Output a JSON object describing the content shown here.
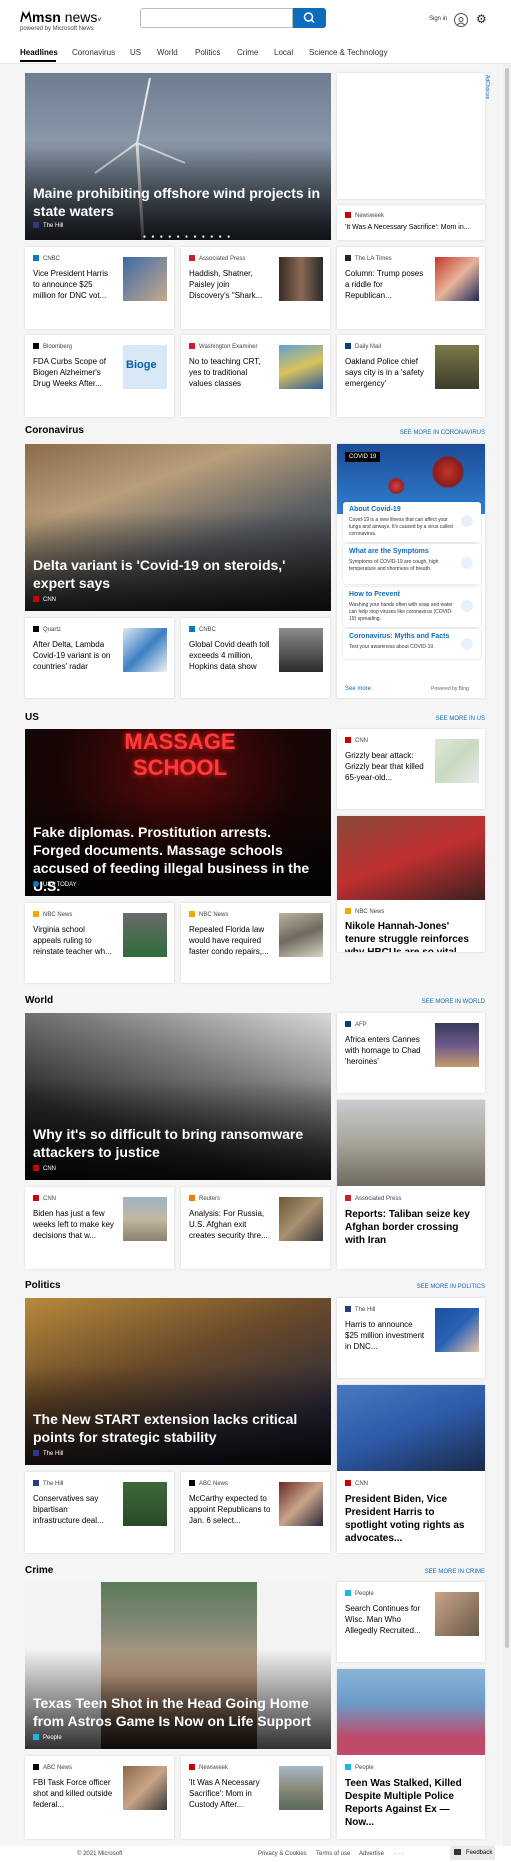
{
  "header": {
    "logo_msn": "msn",
    "logo_section": "news",
    "powered_by": "powered by Microsoft News",
    "search_value": "",
    "sign_in": "Sign in"
  },
  "nav": {
    "items": [
      "Headlines",
      "Coronavirus",
      "US",
      "World",
      "Politics",
      "Crime",
      "Local",
      "Science & Technology"
    ]
  },
  "headlines": {
    "hero_title": "Maine prohibiting offshore wind projects in state waters",
    "hero_source": "The Hill",
    "ad_label": "AdChoices",
    "side_pub": "Newsweek",
    "side_title": "'It Was A Necessary Sacrifice': Mom in...",
    "row1": [
      {
        "pub": "CNBC",
        "title": "Vice President Harris to announce $25 million for DNC vot..."
      },
      {
        "pub": "Associated Press",
        "title": "Haddish, Shatner, Paisley join Discovery's \"Shark..."
      },
      {
        "pub": "The LA Times",
        "title": "Column: Trump poses a riddle for Republican..."
      }
    ],
    "row2": [
      {
        "pub": "Bloomberg",
        "title": "FDA Curbs Scope of Biogen Alzheimer's Drug Weeks After..."
      },
      {
        "pub": "Washington Examiner",
        "title": "No to teaching CRT, yes to traditional values classes"
      },
      {
        "pub": "Daily Mail",
        "title": "Oakland Police chief says city is in a 'safety emergency'"
      }
    ]
  },
  "coronavirus": {
    "title": "Coronavirus",
    "see_more": "SEE MORE IN CORONAVIRUS",
    "hero_title": "Delta variant is 'Covid-19 on steroids,' expert says",
    "hero_source": "CNN",
    "cards": [
      {
        "pub": "Quartz",
        "title": "After Delta, Lambda Covid-19 variant is on countries' radar"
      },
      {
        "pub": "CNBC",
        "title": "Global Covid death toll exceeds 4 million, Hopkins data show"
      }
    ],
    "covid_badge": "COVID 19",
    "panel": [
      {
        "h": "About Covid-19",
        "d": "Covid-19 is a new illness that can affect your lungs and airways. It's caused by a virus called coronavirus."
      },
      {
        "h": "What are the Symptoms",
        "d": "Symptoms of COVID-19 are cough, high temperature and shortness of breath."
      },
      {
        "h": "How to Prevent",
        "d": "Washing your hands often with soap and water can help stop viruses like coronavirus (COVID-19) spreading."
      },
      {
        "h": "Coronavirus: Myths and Facts",
        "d": "Test your awareness about COVID-19."
      }
    ],
    "see_more_link": "See more",
    "powered": "Powered by Bing"
  },
  "us": {
    "title": "US",
    "see_more": "SEE MORE IN US",
    "hero_title": "Fake diplomas. Prostitution arrests. Forged documents. Massage schools accused of feeding illegal business in the U.S.",
    "hero_source": "USA TODAY",
    "hero_sign": "MASSAGE SCHOOL",
    "side_small": {
      "pub": "CNN",
      "title": "Grizzly bear attack: Grizzly bear that killed 65-year-old..."
    },
    "tall": {
      "pub": "NBC News",
      "title": "Nikole Hannah-Jones' tenure struggle reinforces why HBCUs are so vital"
    },
    "cards": [
      {
        "pub": "NBC News",
        "title": "Virginia school appeals ruling to reinstate teacher wh..."
      },
      {
        "pub": "NBC News",
        "title": "Repealed Florida law would have required faster condo repairs,..."
      }
    ]
  },
  "world": {
    "title": "World",
    "see_more": "SEE MORE IN WORLD",
    "hero_title": "Why it's so difficult to bring ransomware attackers to justice",
    "hero_source": "CNN",
    "side_small": {
      "pub": "AFP",
      "title": "Africa enters Cannes with homage to Chad 'heroines'"
    },
    "tall": {
      "pub": "Associated Press",
      "title": "Reports: Taliban seize key Afghan border crossing with Iran"
    },
    "cards": [
      {
        "pub": "CNN",
        "title": "Biden has just a few weeks left to make key decisions that w..."
      },
      {
        "pub": "Reuters",
        "title": "Analysis: For Russia, U.S. Afghan exit creates security thre..."
      }
    ]
  },
  "politics": {
    "title": "Politics",
    "see_more": "SEE MORE IN POLITICS",
    "hero_title": "The New START extension lacks critical points for strategic stability",
    "hero_source": "The Hill",
    "side_small": {
      "pub": "The Hill",
      "title": "Harris to announce $25 million investment in DNC..."
    },
    "tall": {
      "pub": "CNN",
      "title": "President Biden, Vice President Harris to spotlight voting rights as advocates..."
    },
    "cards": [
      {
        "pub": "The Hill",
        "title": "Conservatives say bipartisan infrastructure deal..."
      },
      {
        "pub": "ABC News",
        "title": "McCarthy expected to appoint Republicans to Jan. 6 select..."
      }
    ]
  },
  "crime": {
    "title": "Crime",
    "see_more": "SEE MORE IN CRIME",
    "hero_title": "Texas Teen Shot in the Head Going Home from Astros Game Is Now on Life Support",
    "hero_source": "People",
    "side_small": {
      "pub": "People",
      "title": "Search Continues for Wisc. Man Who Allegedly Recruited..."
    },
    "tall": {
      "pub": "People",
      "title": "Teen Was Stalked, Killed Despite Multiple Police Reports Against Ex — Now..."
    },
    "cards": [
      {
        "pub": "ABC News",
        "title": "FBI Task Force officer shot and killed outside federal..."
      },
      {
        "pub": "Newsweek",
        "title": "'It Was A Necessary Sacrifice': Mom in Custody After..."
      }
    ]
  },
  "footer": {
    "copyright": "© 2021 Microsoft",
    "links": [
      "Privacy & Cookies",
      "Terms of use",
      "Advertise"
    ],
    "more": "· · ·",
    "feedback": "Feedback"
  },
  "colors": {
    "accent": "#0f6cbd",
    "cnn": "#cc0000",
    "cnbc": "#0a7bc0",
    "ap": "#cc1f2d",
    "people": "#1eb4e6",
    "hill": "#2b3a88"
  }
}
